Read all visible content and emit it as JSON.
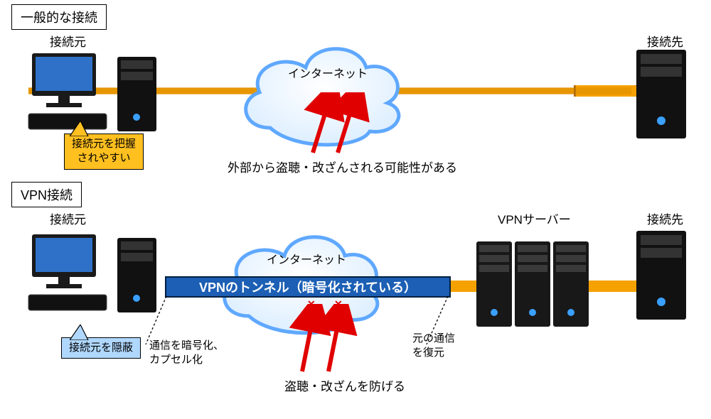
{
  "top": {
    "section_title": "一般的な接続",
    "source_label": "接続元",
    "dest_label": "接続先",
    "cloud_label": "インターネット",
    "callout_source": "接続元を把握\nされやすい",
    "threat_caption": "外部から盗聴・改ざんされる可能性がある"
  },
  "bottom": {
    "section_title": "VPN接続",
    "source_label": "接続元",
    "dest_label": "接続先",
    "cloud_label": "インターネット",
    "callout_source": "接続元を隠蔽",
    "tunnel_label": "VPNのトンネル（暗号化されている）",
    "note_left": "通信を暗号化、\nカプセル化",
    "note_right": "元の通信\nを復元",
    "vpn_server_label": "VPNサーバー",
    "threat_caption": "盗聴・改ざんを防げる"
  }
}
